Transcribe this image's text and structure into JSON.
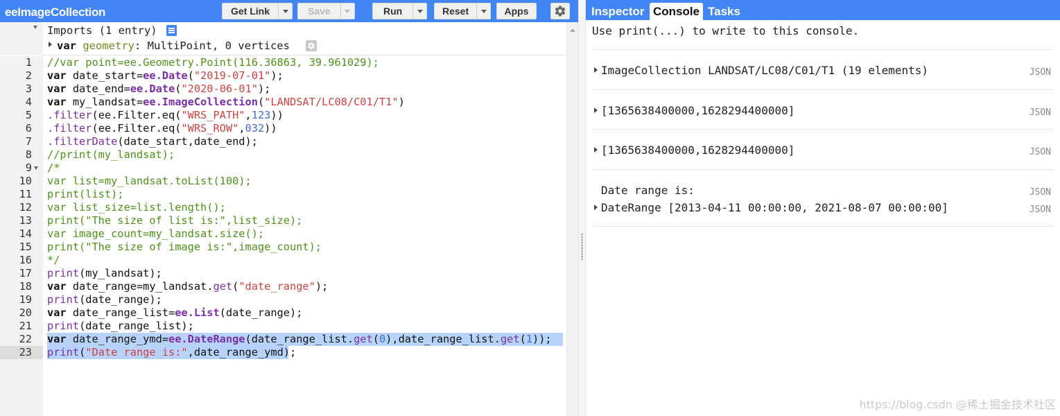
{
  "toolbar": {
    "script_name": "eeImageCollection",
    "get_link": "Get Link",
    "save": "Save",
    "run": "Run",
    "reset": "Reset",
    "apps": "Apps"
  },
  "imports": {
    "title": "Imports (1 entry)",
    "var_keyword": "var",
    "var_name": "geometry",
    "var_desc": ": MultiPoint, 0 vertices"
  },
  "editor": {
    "line_numbers": [
      "1",
      "2",
      "3",
      "4",
      "5",
      "6",
      "7",
      "8",
      "9",
      "10",
      "11",
      "12",
      "13",
      "14",
      "15",
      "16",
      "17",
      "18",
      "19",
      "20",
      "21",
      "22",
      "23"
    ],
    "active_line": 23,
    "lines": [
      [
        [
          "c-com",
          "//var point=ee.Geometry.Point(116.36863, 39.961029);"
        ]
      ],
      [
        [
          "c-kw",
          "var"
        ],
        [
          "c-plain",
          " date_start="
        ],
        [
          "c-ee",
          "ee.Date"
        ],
        [
          "c-plain",
          "("
        ],
        [
          "c-str",
          "\"2019-07-01\""
        ],
        [
          "c-plain",
          ");"
        ]
      ],
      [
        [
          "c-kw",
          "var"
        ],
        [
          "c-plain",
          " date_end="
        ],
        [
          "c-ee",
          "ee.Date"
        ],
        [
          "c-plain",
          "("
        ],
        [
          "c-str",
          "\"2020-06-01\""
        ],
        [
          "c-plain",
          ");"
        ]
      ],
      [
        [
          "c-kw",
          "var"
        ],
        [
          "c-plain",
          " my_landsat="
        ],
        [
          "c-ee",
          "ee.ImageCollection"
        ],
        [
          "c-plain",
          "("
        ],
        [
          "c-str",
          "\"LANDSAT/LC08/C01/T1\""
        ],
        [
          "c-plain",
          ")"
        ]
      ],
      [
        [
          "c-fn",
          ".filter"
        ],
        [
          "c-plain",
          "("
        ],
        [
          "c-plain",
          "ee.Filter.eq"
        ],
        [
          "c-plain",
          "("
        ],
        [
          "c-str",
          "\"WRS_PATH\""
        ],
        [
          "c-plain",
          ","
        ],
        [
          "c-num",
          "123"
        ],
        [
          "c-plain",
          "))"
        ]
      ],
      [
        [
          "c-fn",
          ".filter"
        ],
        [
          "c-plain",
          "("
        ],
        [
          "c-plain",
          "ee.Filter.eq"
        ],
        [
          "c-plain",
          "("
        ],
        [
          "c-str",
          "\"WRS_ROW\""
        ],
        [
          "c-plain",
          ","
        ],
        [
          "c-num",
          "032"
        ],
        [
          "c-plain",
          "))"
        ]
      ],
      [
        [
          "c-fn",
          ".filterDate"
        ],
        [
          "c-plain",
          "(date_start,date_end);"
        ]
      ],
      [
        [
          "c-com",
          "//print(my_landsat);"
        ]
      ],
      [
        [
          "c-com",
          "/*"
        ]
      ],
      [
        [
          "c-com",
          "var list=my_landsat.toList(100);"
        ]
      ],
      [
        [
          "c-com",
          "print(list);"
        ]
      ],
      [
        [
          "c-com",
          "var list_size=list.length();"
        ]
      ],
      [
        [
          "c-com",
          "print(\"The size of list is:\",list_size);"
        ]
      ],
      [
        [
          "c-com",
          "var image_count=my_landsat.size();"
        ]
      ],
      [
        [
          "c-com",
          "print(\"The size of image is:\",image_count);"
        ]
      ],
      [
        [
          "c-com",
          "*/"
        ]
      ],
      [
        [
          "c-fn",
          "print"
        ],
        [
          "c-plain",
          "(my_landsat);"
        ]
      ],
      [
        [
          "c-kw",
          "var"
        ],
        [
          "c-plain",
          " date_range=my_landsat."
        ],
        [
          "c-fn",
          "get"
        ],
        [
          "c-plain",
          "("
        ],
        [
          "c-str",
          "\"date_range\""
        ],
        [
          "c-plain",
          ");"
        ]
      ],
      [
        [
          "c-fn",
          "print"
        ],
        [
          "c-plain",
          "(date_range);"
        ]
      ],
      [
        [
          "c-kw",
          "var"
        ],
        [
          "c-plain",
          " date_range_list="
        ],
        [
          "c-ee",
          "ee.List"
        ],
        [
          "c-plain",
          "(date_range);"
        ]
      ],
      [
        [
          "c-fn",
          "print"
        ],
        [
          "c-plain",
          "(date_range_list);"
        ]
      ],
      [
        [
          "c-kw",
          "var"
        ],
        [
          "c-plain",
          " date_range_ymd="
        ],
        [
          "c-ee",
          "ee.DateRange"
        ],
        [
          "c-plain",
          "(date_range_list."
        ],
        [
          "c-fn",
          "get"
        ],
        [
          "c-plain",
          "("
        ],
        [
          "c-num",
          "0"
        ],
        [
          "c-plain",
          "),date_range_list."
        ],
        [
          "c-fn",
          "get"
        ],
        [
          "c-plain",
          "("
        ],
        [
          "c-num",
          "1"
        ],
        [
          "c-plain",
          "));"
        ]
      ],
      [
        [
          "c-fn",
          "print"
        ],
        [
          "c-plain",
          "("
        ],
        [
          "c-str",
          "\"Date range is:\""
        ],
        [
          "c-plain",
          ",date_range_ymd);"
        ]
      ]
    ]
  },
  "tabs": {
    "inspector": "Inspector",
    "console": "Console",
    "tasks": "Tasks"
  },
  "console": {
    "hint": "Use print(...) to write to this console.",
    "outputs": [
      {
        "text": "ImageCollection LANDSAT/LC08/C01/T1 (19 elements)",
        "json": "JSON"
      },
      {
        "text": "[1365638400000,1628294400000]",
        "json": "JSON"
      },
      {
        "text": "[1365638400000,1628294400000]",
        "json": "JSON"
      },
      {
        "label": "Date range is:",
        "label_json": "JSON",
        "text": "DateRange [2013-04-11 00:00:00, 2021-08-07 00:00:00]",
        "json": "JSON"
      }
    ]
  },
  "watermark": "https://blog.csdn @稀土掘金技术社区"
}
